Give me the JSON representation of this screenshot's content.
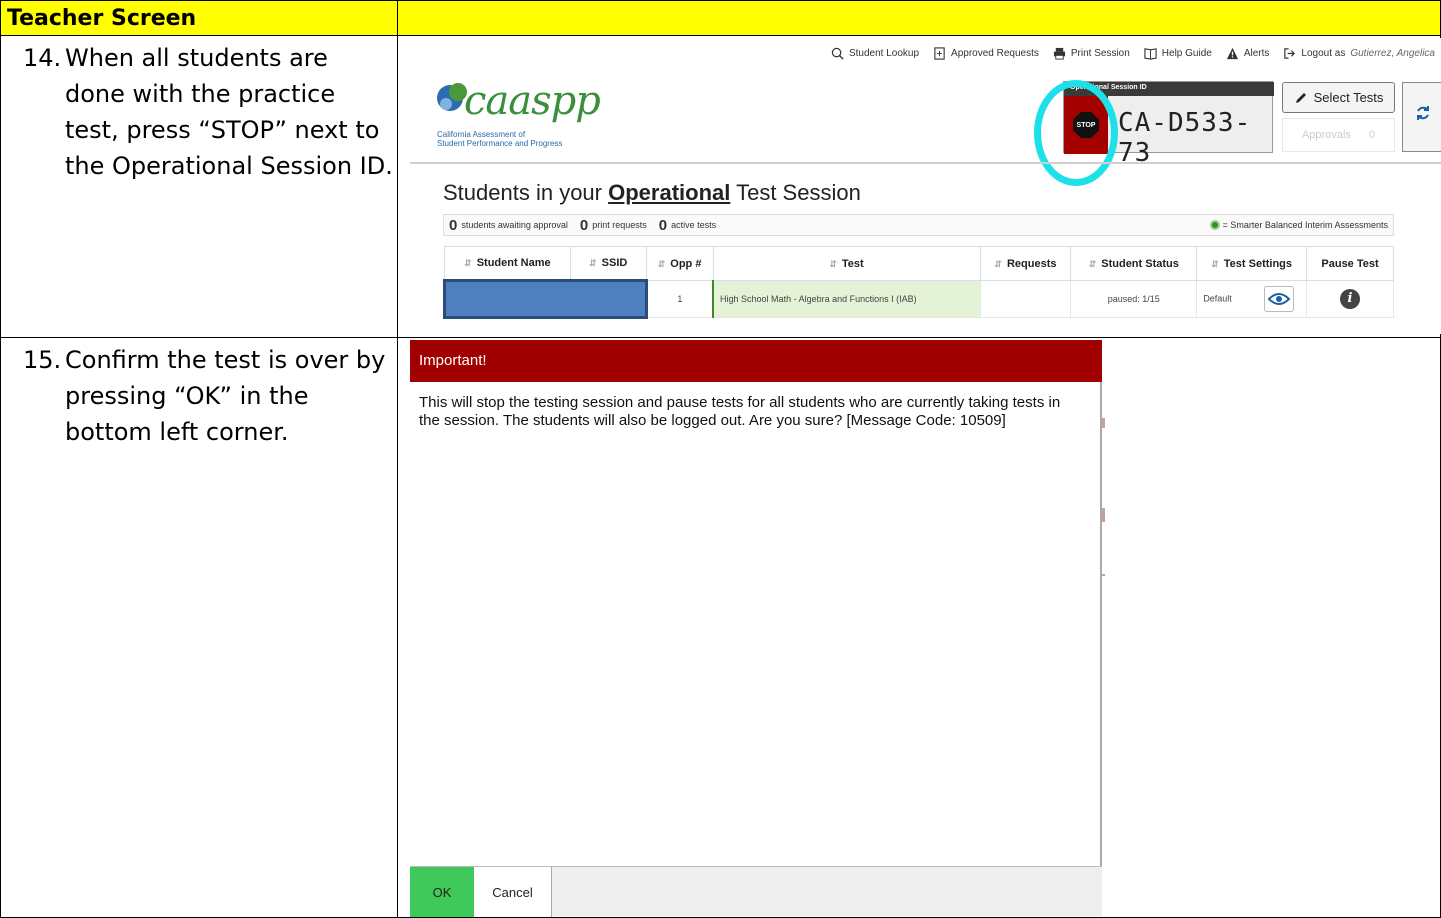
{
  "header": {
    "title": "Teacher Screen"
  },
  "steps": [
    {
      "number": "14.",
      "text": "When all students are done with the practice test, press “STOP” next to the Operational Session ID."
    },
    {
      "number": "15.",
      "text": "Confirm the test is over by pressing “OK” in the bottom left corner."
    }
  ],
  "ta_screen": {
    "nav": {
      "student_lookup": "Student Lookup",
      "approved_requests": "Approved Requests",
      "print_session": "Print Session",
      "help_guide": "Help Guide",
      "alerts": "Alerts",
      "logout": "Logout as",
      "user": "Gutierrez, Angelica"
    },
    "logo": {
      "text": "caaspp",
      "line1": "California Assessment of",
      "line2": "Student Performance and Progress"
    },
    "session": {
      "header": "Operational Session ID",
      "stop_label": "STOP",
      "id": "CA-D533-73"
    },
    "select_tests": "Select Tests",
    "approvals": {
      "label": "Approvals",
      "count": "0"
    },
    "title_pre": "Students in your",
    "title_bold": "Operational",
    "title_post": "Test Session",
    "summary": {
      "awaiting_count": "0",
      "awaiting_label": "students awaiting approval",
      "print_count": "0",
      "print_label": "print requests",
      "active_count": "0",
      "active_label": "active tests",
      "legend": "= Smarter Balanced Interim Assessments"
    },
    "columns": [
      "Student Name",
      "SSID",
      "Opp #",
      "Test",
      "Requests",
      "Student Status",
      "Test Settings",
      "Pause Test"
    ],
    "row": {
      "opp": "1",
      "test": "High School Math - Algebra and Functions I (IAB)",
      "status": "paused: 1/15",
      "settings": "Default"
    },
    "colors": {
      "stop_red": "#a40000",
      "highlight": "#1ee0e8",
      "test_green": "#e4f2d6"
    }
  },
  "dialog": {
    "title": "Important!",
    "message": "This will stop the testing session and pause tests for all students who are currently taking tests in the session. The students will also be logged out. Are you sure? [Message Code: 10509]",
    "ok": "OK",
    "cancel": "Cancel",
    "colors": {
      "header": "#a00000",
      "ok": "#3ec95a"
    }
  }
}
